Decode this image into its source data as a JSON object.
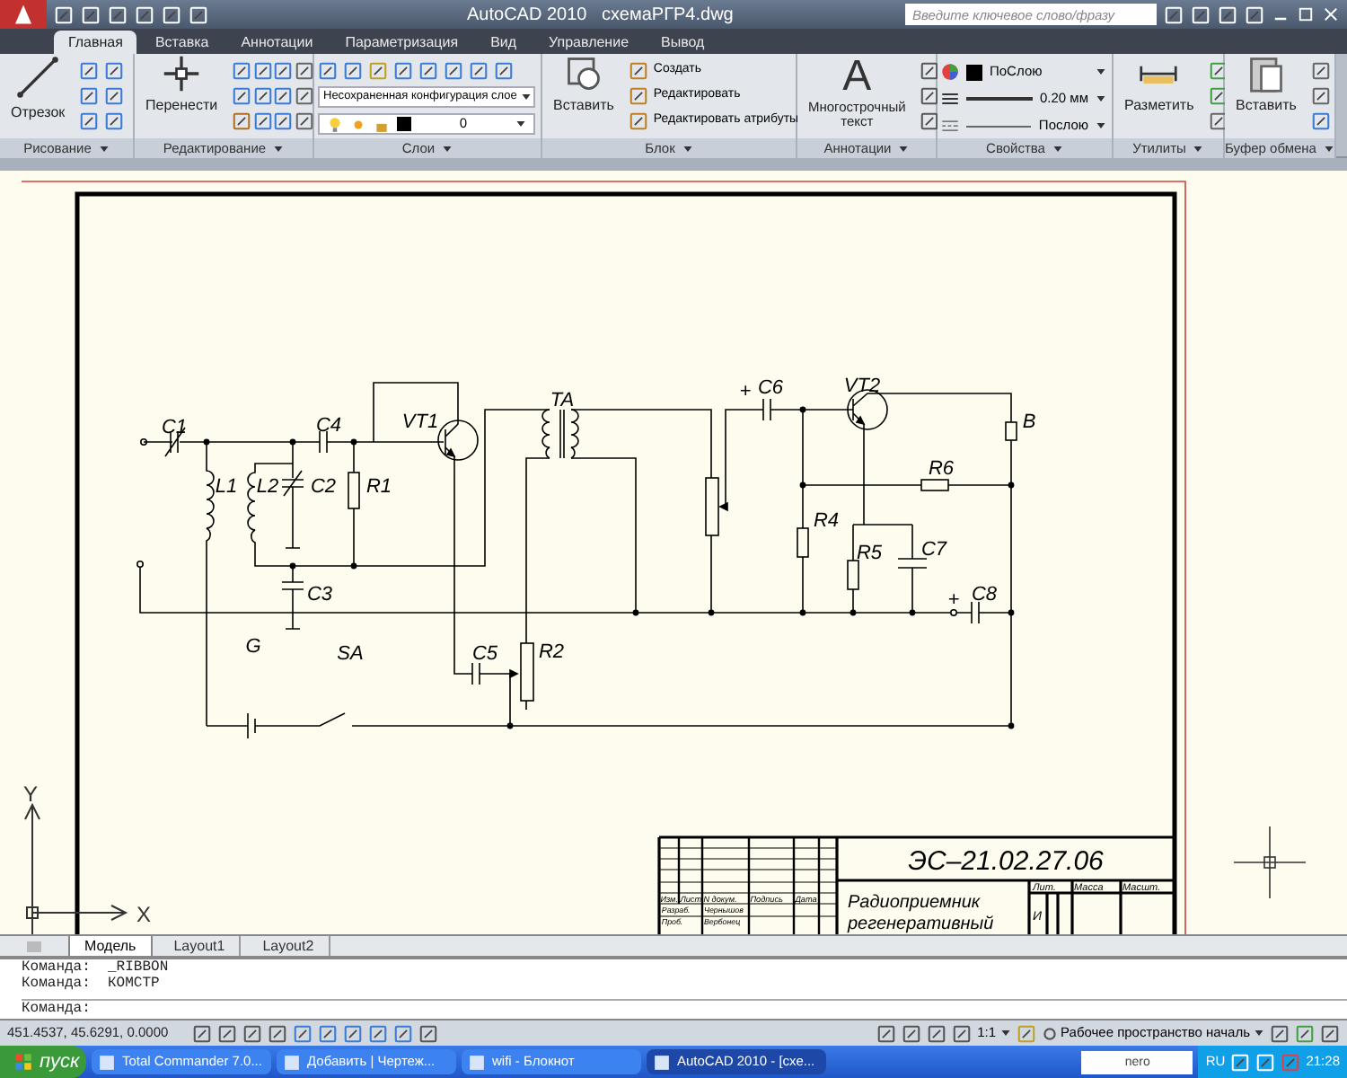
{
  "window": {
    "app": "AutoCAD 2010",
    "file": "схемаРГР4.dwg"
  },
  "search": {
    "placeholder": "Введите ключевое слово/фразу"
  },
  "tabs": [
    {
      "label": "Главная",
      "selected": true
    },
    {
      "label": "Вставка",
      "selected": false
    },
    {
      "label": "Аннотации",
      "selected": false
    },
    {
      "label": "Параметризация",
      "selected": false
    },
    {
      "label": "Вид",
      "selected": false
    },
    {
      "label": "Управление",
      "selected": false
    },
    {
      "label": "Вывод",
      "selected": false
    }
  ],
  "ribbon": [
    {
      "kind": "draw",
      "label": "Рисование",
      "tool": "Отрезок"
    },
    {
      "kind": "modify",
      "label": "Редактирование",
      "tool": "Перенести"
    },
    {
      "kind": "layers",
      "label": "Слои",
      "config": "Несохраненная конфигурация слое",
      "layer": "0"
    },
    {
      "kind": "block",
      "label": "Блок",
      "tool": "Вставить",
      "items": [
        "Создать",
        "Редактировать",
        "Редактировать атрибуты"
      ]
    },
    {
      "kind": "annotation",
      "label": "Аннотации",
      "glyph": "A",
      "tool_lines": [
        "Многострочный",
        "текст"
      ]
    },
    {
      "kind": "properties",
      "label": "Свойства",
      "color_value": "ПоСлою",
      "lineweight": "0.20 мм",
      "linetype": "Послою"
    },
    {
      "kind": "utilities",
      "label": "Утилиты",
      "tool": "Разметить"
    },
    {
      "kind": "clipboard",
      "label": "Буфер обмена",
      "tool": "Вставить"
    }
  ],
  "drawing": {
    "labels": [
      "C1",
      "C4",
      "VT1",
      "TA",
      "+",
      "C6",
      "VT2",
      "B",
      "L1",
      "L2",
      "C2",
      "R1",
      "R6",
      "R4",
      "R5",
      "C7",
      "C3",
      "+",
      "C8",
      "G",
      "SA",
      "C5",
      "R2"
    ],
    "ucs": {
      "y": "Y",
      "x": "X"
    },
    "title_block": {
      "designation": "ЭС–21.02.27.06",
      "title_lines": [
        "Радиоприемник",
        "регенеративный"
      ],
      "headers": [
        "Изм.",
        "Лист",
        "N докум.",
        "Подпись",
        "Дата"
      ],
      "rows": [
        [
          "Разраб.",
          "Чернышов"
        ],
        [
          "Проб.",
          "Вербонец"
        ]
      ],
      "right_headers": [
        "Лит.",
        "Масса",
        "Масшт."
      ],
      "letter": "И"
    }
  },
  "layout_tabs": [
    {
      "label": "Модель",
      "selected": true
    },
    {
      "label": "Layout1",
      "selected": false
    },
    {
      "label": "Layout2",
      "selected": false
    }
  ],
  "command_history": [
    "Команда:  _RIBBON",
    "Команда:  КОМСТР"
  ],
  "command_prompt": "Команда:",
  "status_bar": {
    "coordinates": "451.4537, 45.6291, 0.0000",
    "scale": "1:1",
    "workspace": "Рабочее пространство началь"
  },
  "taskbar": {
    "start": "пуск",
    "tasks": [
      {
        "label": "Total Commander 7.0...",
        "selected": false
      },
      {
        "label": "Добавить | Чертеж...",
        "selected": false
      },
      {
        "label": "wifi - Блокнот",
        "selected": false
      },
      {
        "label": "AutoCAD 2010 - [схе...",
        "selected": true
      }
    ],
    "tray_box": "nero",
    "language": "RU",
    "clock": "21:28"
  }
}
